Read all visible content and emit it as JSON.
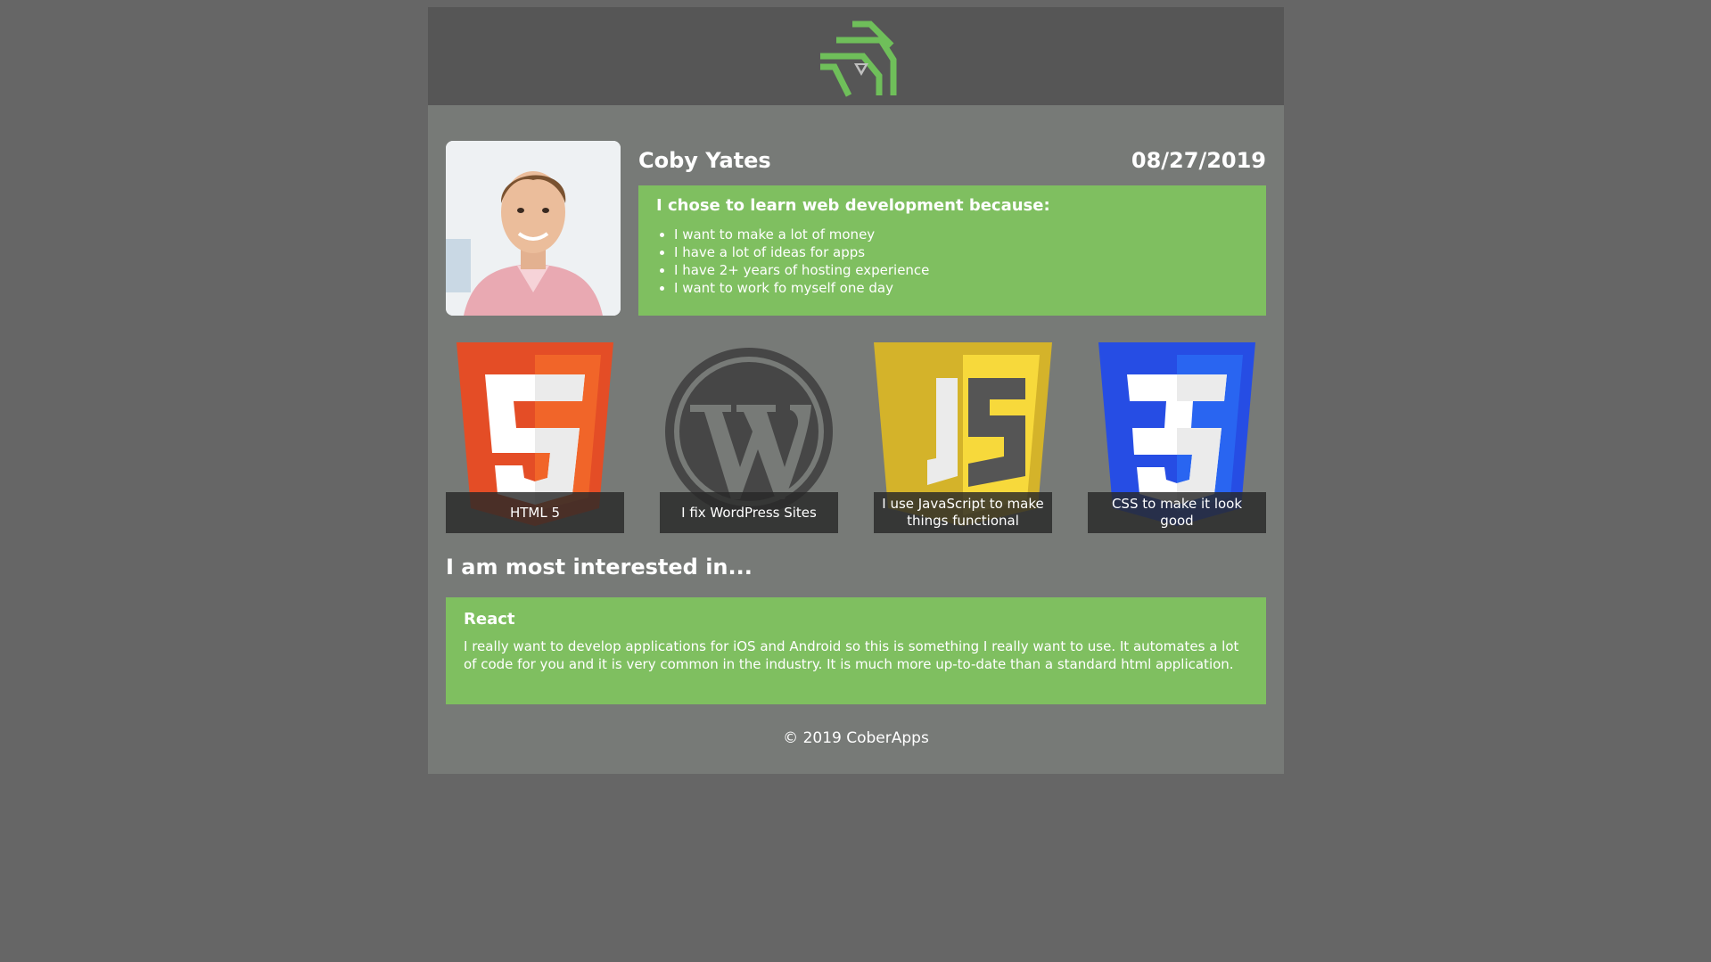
{
  "header": {
    "logo_icon": "green-geometric-logo-icon"
  },
  "profile": {
    "photo_icon": "profile-photo",
    "name": "Coby Yates",
    "date": "08/27/2019"
  },
  "reasons": {
    "title": "I chose to learn web development because:",
    "items": [
      "I want to make a lot of money",
      "I have a lot of ideas for apps",
      "I have 2+ years of hosting experience",
      "I want to work fo myself one day"
    ]
  },
  "skills": [
    {
      "icon": "html5-icon",
      "caption": "HTML 5"
    },
    {
      "icon": "wordpress-icon",
      "caption": "I fix WordPress Sites"
    },
    {
      "icon": "javascript-icon",
      "caption": "I use JavaScript to make things functional"
    },
    {
      "icon": "css3-icon",
      "caption": "CSS to make it look good"
    }
  ],
  "interest": {
    "heading": "I am most interested in...",
    "title": "React",
    "body": "I really want to develop applications for iOS and Android so this is something I really want to use. It automates a lot of code for you and it is very common in the industry. It is much more up-to-date than a standard html application."
  },
  "footer": {
    "text": "© 2019 CoberApps"
  },
  "colors": {
    "background": "#666666",
    "page": "#777a77",
    "header": "#565656",
    "accent_green": "#7fbf60",
    "html_orange": "#e44d26",
    "js_yellow": "#d4b32a",
    "css_blue": "#264de4"
  }
}
